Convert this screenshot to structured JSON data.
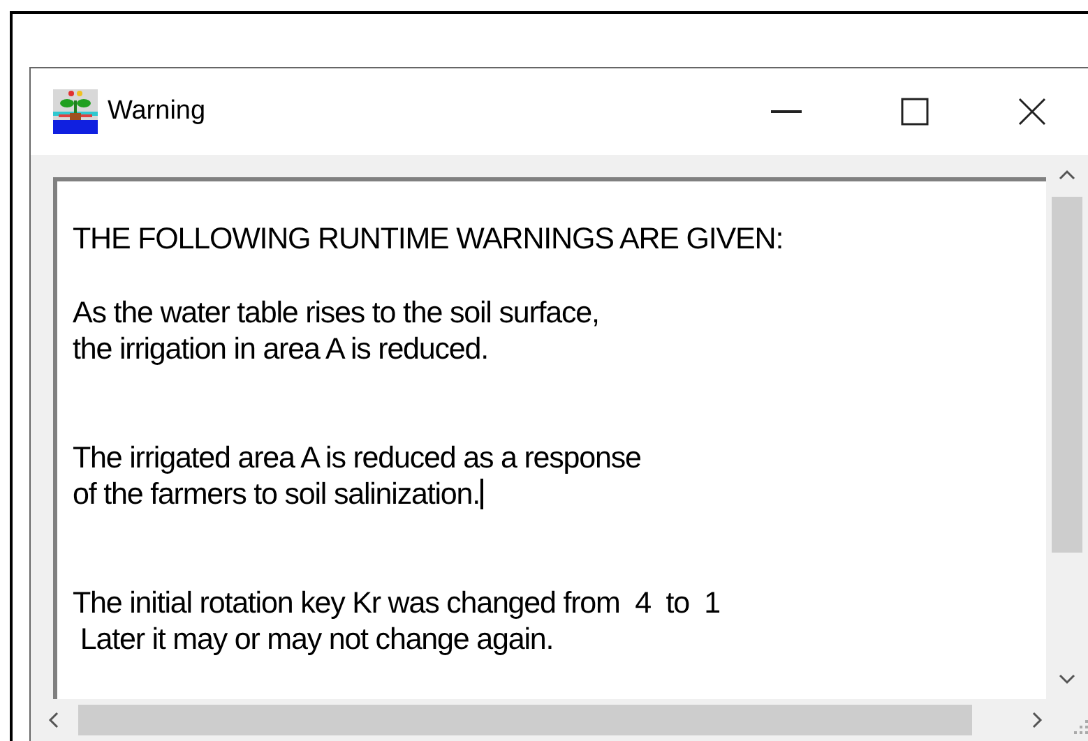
{
  "window": {
    "title": "Warning"
  },
  "message": {
    "heading": "THE FOLLOWING RUNTIME WARNINGS ARE GIVEN:",
    "paragraphs": [
      {
        "lines": [
          {
            "text": "As the water table rises to the soil surface,",
            "caret": false
          },
          {
            "text": "the irrigation in area A is reduced.",
            "caret": false
          }
        ]
      },
      {
        "lines": [
          {
            "text": "The irrigated area A is reduced as a response",
            "caret": false
          },
          {
            "text": "of the farmers to soil salinization.",
            "caret": true
          }
        ]
      },
      {
        "lines": [
          {
            "text": "The initial rotation key Kr was changed from  4  to  1",
            "caret": false
          },
          {
            "text": " Later it may or may not change again.",
            "caret": false
          }
        ]
      }
    ]
  }
}
